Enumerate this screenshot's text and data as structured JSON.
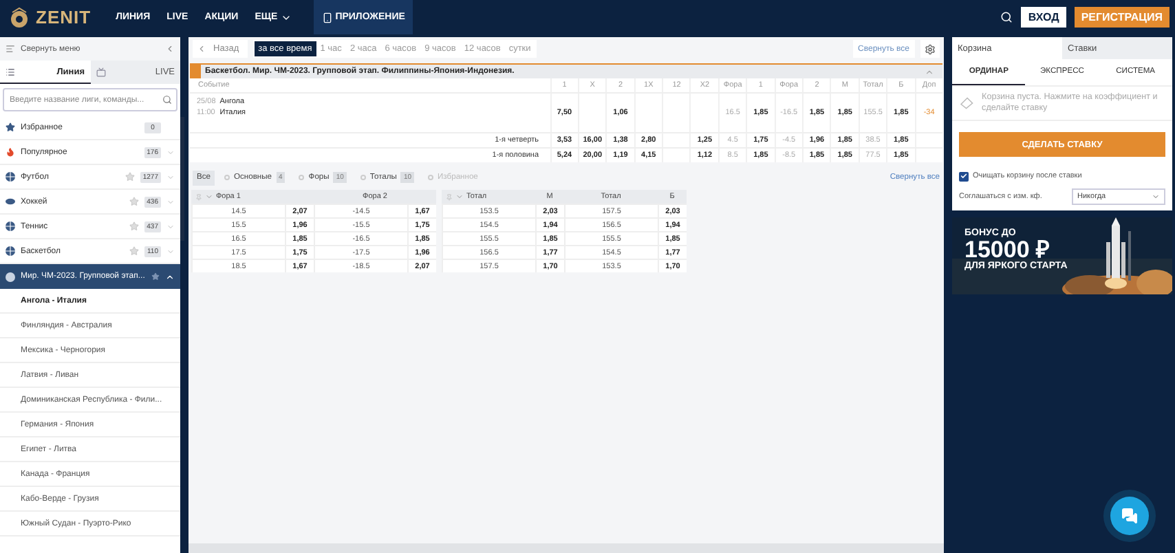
{
  "header": {
    "logo": "ZENIT",
    "nav": [
      {
        "label": "ЛИНИЯ",
        "kind": "link",
        "selected": false
      },
      {
        "label": "LIVE",
        "kind": "link",
        "selected": false
      },
      {
        "label": "АКЦИИ",
        "kind": "link",
        "selected": false
      },
      {
        "label": "ЕЩЕ",
        "kind": "dropdown",
        "selected": false
      },
      {
        "label": "ПРИЛОЖЕНИЕ",
        "kind": "app",
        "selected": true
      }
    ],
    "login": "ВХОД",
    "register": "РЕГИСТРАЦИЯ"
  },
  "sidebar": {
    "collapse": "Свернуть меню",
    "tabs": [
      {
        "label": "Линия",
        "selected": true
      },
      {
        "label": "LIVE",
        "selected": false
      }
    ],
    "search": {
      "placeholder": "Введите название лиги, команды..."
    },
    "sports": [
      {
        "name": "Избранное",
        "count": "0",
        "kind": "favorites"
      },
      {
        "name": "Популярное",
        "count": "176",
        "kind": "popular"
      },
      {
        "name": "Футбол",
        "count": "1277",
        "kind": "football"
      },
      {
        "name": "Хоккей",
        "count": "436",
        "kind": "hockey"
      },
      {
        "name": "Теннис",
        "count": "437",
        "kind": "tennis"
      },
      {
        "name": "Баскетбол",
        "count": "110",
        "kind": "basketball"
      }
    ],
    "league": {
      "name": "Мир. ЧМ-2023. Групповой этап...",
      "expanded": true,
      "matches": [
        {
          "name": "Ангола - Италия",
          "selected": true
        },
        {
          "name": "Финляндия - Австралия",
          "selected": false
        },
        {
          "name": "Мексика - Черногория",
          "selected": false
        },
        {
          "name": "Латвия - Ливан",
          "selected": false
        },
        {
          "name": "Доминиканская Республика - Фили...",
          "selected": false
        },
        {
          "name": "Германия - Япония",
          "selected": false
        },
        {
          "name": "Египет - Литва",
          "selected": false
        },
        {
          "name": "Канада - Франция",
          "selected": false
        },
        {
          "name": "Кабо-Верде - Грузия",
          "selected": false
        },
        {
          "name": "Южный Судан - Пуэрто-Рико",
          "selected": false
        }
      ]
    }
  },
  "main": {
    "back": "Назад",
    "periods": [
      {
        "label": "за все время",
        "selected": true
      },
      {
        "label": "1 час",
        "selected": false
      },
      {
        "label": "2 часа",
        "selected": false
      },
      {
        "label": "6 часов",
        "selected": false
      },
      {
        "label": "9 часов",
        "selected": false
      },
      {
        "label": "12 часов",
        "selected": false
      },
      {
        "label": "сутки",
        "selected": false
      }
    ],
    "collapse_all": "Свернуть все",
    "event_block": {
      "title": "Баскетбол. Мир. ЧМ-2023. Групповой этап. Филиппины-Япония-Индонезия.",
      "expanded": true,
      "event_label": "Событие",
      "columns": [
        {
          "label": "1",
          "kind": "odd"
        },
        {
          "label": "X",
          "kind": "odd"
        },
        {
          "label": "2",
          "kind": "odd"
        },
        {
          "label": "1X",
          "kind": "odd"
        },
        {
          "label": "12",
          "kind": "odd"
        },
        {
          "label": "X2",
          "kind": "odd"
        },
        {
          "label": "Фора",
          "kind": "line"
        },
        {
          "label": "1",
          "kind": "odd"
        },
        {
          "label": "Фора",
          "kind": "line"
        },
        {
          "label": "2",
          "kind": "odd"
        },
        {
          "label": "М",
          "kind": "odd"
        },
        {
          "label": "Тотал",
          "kind": "line"
        },
        {
          "label": "Б",
          "kind": "odd"
        },
        {
          "label": "Доп",
          "kind": "extra"
        }
      ],
      "event": {
        "date": "25/08",
        "time": "11:00",
        "team1": "Ангола",
        "team2": "Италия",
        "cells": [
          "7,50",
          "",
          "1,06",
          "",
          "",
          "",
          "16.5",
          "1,85",
          "-16.5",
          "1,85",
          "1,85",
          "155.5",
          "1,85",
          "-34"
        ]
      },
      "sub_rows": [
        {
          "label": "1-я четверть",
          "cells": [
            "3,53",
            "16,00",
            "1,38",
            "2,80",
            "",
            "1,25",
            "4.5",
            "1,75",
            "-4.5",
            "1,96",
            "1,85",
            "38.5",
            "1,85",
            ""
          ]
        },
        {
          "label": "1-я половина",
          "cells": [
            "5,24",
            "20,00",
            "1,19",
            "4,15",
            "",
            "1,12",
            "8.5",
            "1,85",
            "-8.5",
            "1,85",
            "1,85",
            "77.5",
            "1,85",
            ""
          ]
        }
      ]
    },
    "filters": [
      {
        "label": "Все",
        "selected": true,
        "disabled": false
      },
      {
        "label": "Основные",
        "count": "4",
        "selected": false,
        "disabled": false
      },
      {
        "label": "Форы",
        "count": "10",
        "selected": false,
        "disabled": false
      },
      {
        "label": "Тоталы",
        "count": "10",
        "selected": false,
        "disabled": false
      },
      {
        "label": "Избранное",
        "selected": false,
        "disabled": true
      }
    ],
    "collapse_all_markets": "Свернуть все",
    "markets": [
      {
        "headers": [
          {
            "label": "Фора 1",
            "kind": "wide"
          },
          {
            "label": "Фора 2",
            "kind": "wide"
          }
        ],
        "rows": [
          [
            "14.5",
            "2,07",
            "-14.5",
            "1,67"
          ],
          [
            "15.5",
            "1,96",
            "-15.5",
            "1,75"
          ],
          [
            "16.5",
            "1,85",
            "-16.5",
            "1,85"
          ],
          [
            "17.5",
            "1,75",
            "-17.5",
            "1,96"
          ],
          [
            "18.5",
            "1,67",
            "-18.5",
            "2,07"
          ]
        ]
      },
      {
        "headers": [
          {
            "label": "Тотал",
            "kind": "narrow"
          },
          {
            "label": "М",
            "kind": "narrow"
          },
          {
            "label": "Тотал",
            "kind": "narrow"
          },
          {
            "label": "Б",
            "kind": "narrow"
          }
        ],
        "rows": [
          [
            "153.5",
            "2,03",
            "157.5",
            "2,03"
          ],
          [
            "154.5",
            "1,94",
            "156.5",
            "1,94"
          ],
          [
            "155.5",
            "1,85",
            "155.5",
            "1,85"
          ],
          [
            "156.5",
            "1,77",
            "154.5",
            "1,77"
          ],
          [
            "157.5",
            "1,70",
            "153.5",
            "1,70"
          ]
        ]
      }
    ]
  },
  "betslip": {
    "tabs": [
      {
        "label": "Корзина",
        "selected": true
      },
      {
        "label": "Ставки",
        "selected": false
      }
    ],
    "bet_types": [
      {
        "label": "ОРДИНАР",
        "selected": true
      },
      {
        "label": "ЭКСПРЕСС",
        "selected": false
      },
      {
        "label": "СИСТЕМА",
        "selected": false
      }
    ],
    "empty_message": "Корзина пуста. Нажмите на коэффициент и сделайте ставку",
    "place_bet": "СДЕЛАТЬ СТАВКУ",
    "clear_after": {
      "label": "Очищать корзину после ставки",
      "checked": true
    },
    "accept_changes": {
      "label": "Соглашаться с изм. кф.",
      "value": "Никогда"
    }
  },
  "banner": {
    "line1": "БОНУС ДО",
    "amount": "15000 ₽",
    "line3": "ДЛЯ ЯРКОГО СТАРТА"
  }
}
